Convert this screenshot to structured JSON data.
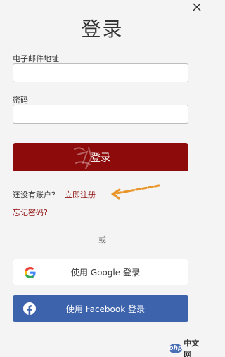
{
  "dialog": {
    "title": "登录",
    "close_icon": "close-icon"
  },
  "form": {
    "email_label": "电子邮件地址",
    "email_value": "",
    "password_label": "密码",
    "password_value": "",
    "login_button": "登录"
  },
  "links": {
    "no_account": "还没有账户？",
    "register": "立即注册",
    "forgot_password": "忘记密码?"
  },
  "divider_text": "或",
  "social": {
    "google_label": "使用 Google 登录",
    "google_icon": "google-icon",
    "facebook_label": "使用 Facebook 登录",
    "facebook_icon": "facebook-icon"
  },
  "branding": {
    "badge": "php",
    "text": "中文网"
  },
  "colors": {
    "primary": "#8e0b0b",
    "facebook": "#3e63ad",
    "background": "#f4f4f4",
    "annotation_arrow": "#e8962a"
  }
}
